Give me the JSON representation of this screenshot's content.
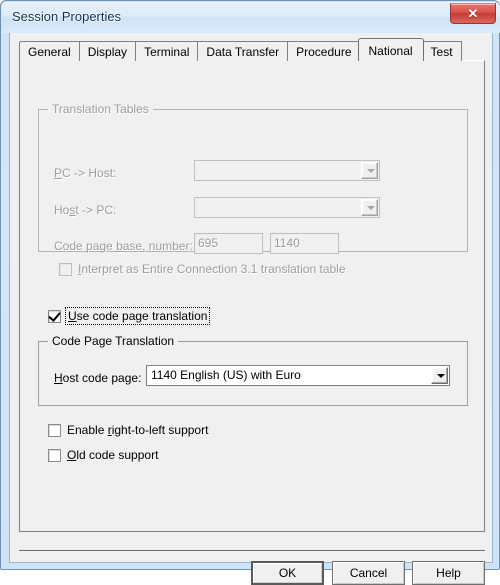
{
  "window": {
    "title": "Session Properties",
    "close_label": "✕"
  },
  "tabs": [
    {
      "label": "General",
      "active": false
    },
    {
      "label": "Display",
      "active": false
    },
    {
      "label": "Terminal",
      "active": false
    },
    {
      "label": "Data Transfer",
      "active": false
    },
    {
      "label": "Procedure",
      "active": false
    },
    {
      "label": "National",
      "active": true
    },
    {
      "label": "Test",
      "active": false
    }
  ],
  "translation_tables": {
    "title": "Translation Tables",
    "enabled": false,
    "pc_to_host": {
      "label_pre": "",
      "label_acc": "P",
      "label_post": "C -> Host:",
      "value": ""
    },
    "host_to_pc": {
      "label_pre": "Ho",
      "label_acc": "s",
      "label_post": "t -> PC:",
      "value": ""
    },
    "code_page_base": {
      "label_pre": "Code page ",
      "label_acc": "b",
      "label_post": "ase, number:",
      "value_left": "695",
      "value_right": "1140"
    },
    "interpret_checkbox": {
      "label_acc": "I",
      "label_post": "nterpret as Entire Connection 3.1 translation table",
      "checked": false
    }
  },
  "use_code_page": {
    "label_acc": "U",
    "label_post": "se code page translation",
    "checked": true,
    "focused": true
  },
  "code_page_translation": {
    "title": "Code Page Translation",
    "host_code_page": {
      "label_acc": "H",
      "label_post": "ost code page:",
      "value": "1140 English (US) with Euro"
    }
  },
  "options": [
    {
      "label_pre": "Enable ",
      "label_acc": "r",
      "label_post": "ight-to-left support",
      "checked": false
    },
    {
      "label_pre": "",
      "label_acc": "O",
      "label_post": "ld code support",
      "checked": false
    }
  ],
  "footer": {
    "ok": "OK",
    "cancel": "Cancel",
    "help": "Help"
  }
}
